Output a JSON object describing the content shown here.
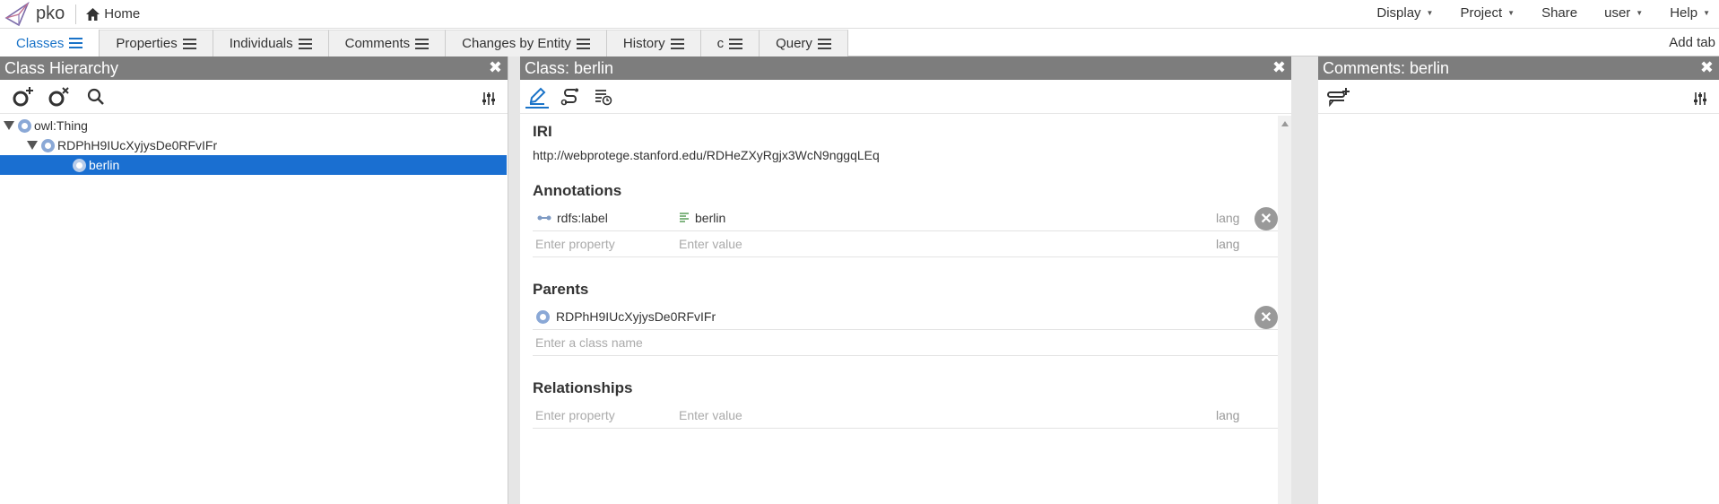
{
  "app": {
    "name": "pko",
    "home_label": "Home"
  },
  "menus": [
    {
      "label": "Display",
      "caret": true
    },
    {
      "label": "Project",
      "caret": true
    },
    {
      "label": "Share",
      "caret": false
    },
    {
      "label": "user",
      "caret": true
    },
    {
      "label": "Help",
      "caret": true
    }
  ],
  "tabs": [
    {
      "label": "Classes",
      "active": true
    },
    {
      "label": "Properties"
    },
    {
      "label": "Individuals"
    },
    {
      "label": "Comments"
    },
    {
      "label": "Changes by Entity"
    },
    {
      "label": "History"
    },
    {
      "label": "c"
    },
    {
      "label": "Query"
    }
  ],
  "add_tab_label": "Add tab",
  "hierarchy": {
    "title": "Class Hierarchy",
    "tree": [
      {
        "label": "owl:Thing",
        "level": 0,
        "expanded": true
      },
      {
        "label": "RDPhH9IUcXyjysDe0RFvIFr",
        "level": 1,
        "expanded": true
      },
      {
        "label": "berlin",
        "level": 2,
        "selected": true
      }
    ]
  },
  "editor": {
    "title": "Class: berlin",
    "iri_title": "IRI",
    "iri": "http://webprotege.stanford.edu/RDHeZXyRgjx3WcN9nggqLEq",
    "annotations_title": "Annotations",
    "annotations": [
      {
        "property": "rdfs:label",
        "value": "berlin",
        "lang": "lang"
      }
    ],
    "annotation_placeholder": {
      "property": "Enter property",
      "value": "Enter value",
      "lang": "lang"
    },
    "parents_title": "Parents",
    "parents": [
      {
        "label": "RDPhH9IUcXyjysDe0RFvIFr"
      }
    ],
    "parent_placeholder": "Enter a class name",
    "relationships_title": "Relationships",
    "relationship_placeholder": {
      "property": "Enter property",
      "value": "Enter value",
      "lang": "lang"
    }
  },
  "comments": {
    "title": "Comments: berlin"
  },
  "colors": {
    "header_bg": "#7d7d7d",
    "accent": "#1a73c8",
    "selected_bg": "#1a6fd1"
  }
}
